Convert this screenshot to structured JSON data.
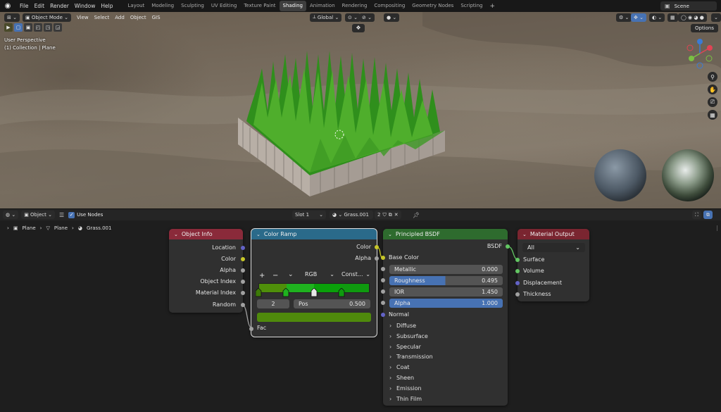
{
  "topbar": {
    "menus": [
      "File",
      "Edit",
      "Render",
      "Window",
      "Help"
    ],
    "workspaces": [
      "Layout",
      "Modeling",
      "Sculpting",
      "UV Editing",
      "Texture Paint",
      "Shading",
      "Animation",
      "Rendering",
      "Compositing",
      "Geometry Nodes",
      "Scripting"
    ],
    "active_workspace": "Shading",
    "add_label": "+",
    "scene": "Scene"
  },
  "viewport": {
    "mode": "Object Mode",
    "menus": [
      "View",
      "Select",
      "Add",
      "Object",
      "GIS"
    ],
    "orientation": "Global",
    "view_name": "User Perspective",
    "collection": "(1) Collection | Plane",
    "options": "Options"
  },
  "node_editor": {
    "editor_type": "Object",
    "use_nodes": "Use Nodes",
    "slot": "Slot 1",
    "material": "Grass.001",
    "users": "2",
    "breadcrumb": [
      "Plane",
      "Plane",
      "Grass.001"
    ]
  },
  "nodes": {
    "object_info": {
      "title": "Object Info",
      "outputs": [
        "Location",
        "Color",
        "Alpha",
        "Object Index",
        "Material Index",
        "Random"
      ]
    },
    "color_ramp": {
      "title": "Color Ramp",
      "outputs": [
        "Color",
        "Alpha"
      ],
      "add": "+",
      "remove": "−",
      "menu": "⌄",
      "color_mode": "RGB",
      "interpolation": "Const...",
      "index": "2",
      "pos_label": "Pos",
      "pos_value": "0.500",
      "input": "Fac",
      "ramp_colors": [
        "#4f8f0a",
        "#1fb21f",
        "#0aa00a",
        "#0f9a0f"
      ],
      "stop_positions": [
        0.0,
        0.25,
        0.5,
        0.75
      ],
      "selected_color": "#4f8a0c"
    },
    "principled": {
      "title": "Principled BSDF",
      "output": "BSDF",
      "base_color": "Base Color",
      "metallic_label": "Metallic",
      "metallic": "0.000",
      "roughness_label": "Roughness",
      "roughness": "0.495",
      "ior_label": "IOR",
      "ior": "1.450",
      "alpha_label": "Alpha",
      "alpha": "1.000",
      "normal": "Normal",
      "panels": [
        "Subsurface",
        "Specular",
        "Transmission",
        "Coat",
        "Sheen",
        "Emission",
        "Thin Film"
      ],
      "first_panel": "Diffuse"
    },
    "material_output": {
      "title": "Material Output",
      "target": "All",
      "inputs": [
        "Surface",
        "Volume",
        "Displacement",
        "Thickness"
      ]
    }
  },
  "colors": {
    "object_info_header": "#8a2a3a",
    "color_ramp_header": "#2a6a8a",
    "principled_header": "#2e6b2e",
    "material_output_header": "#7a2530",
    "accent": "#4772b3"
  }
}
